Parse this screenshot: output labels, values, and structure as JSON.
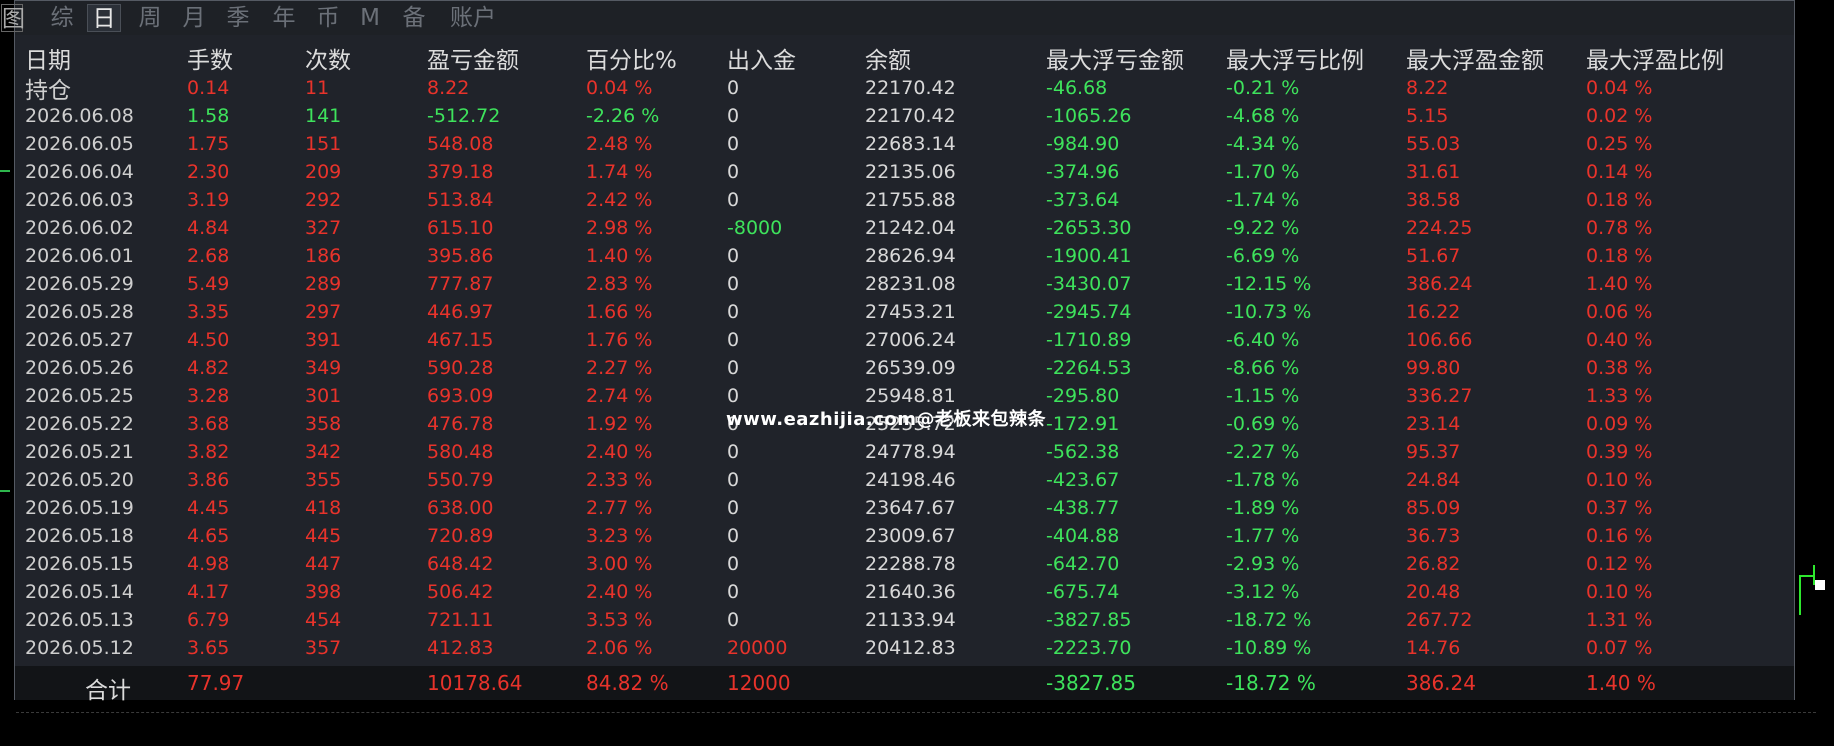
{
  "tabs": [
    "图",
    "综",
    "日",
    "周",
    "月",
    "季",
    "年",
    "币",
    "M",
    "备",
    "账户"
  ],
  "active_tab": "日",
  "columns": [
    "日期",
    "手数",
    "次数",
    "盈亏金额",
    "百分比%",
    "出入金",
    "余额",
    "最大浮亏金额",
    "最大浮亏比例",
    "最大浮盈金额",
    "最大浮盈比例"
  ],
  "colors": {
    "profit": "#e8332b",
    "loss": "#3ee35c",
    "neutral": "#d8d8d8",
    "panel": "#20232a"
  },
  "rows": [
    {
      "date": "持仓",
      "lots": "0.14",
      "count": "11",
      "pnl": "8.22",
      "pct": "0.04 %",
      "flow": "0",
      "balance": "22170.42",
      "maxloss": "-46.68",
      "maxloss_pct": "-0.21 %",
      "maxprofit": "8.22",
      "maxprofit_pct": "0.04 %",
      "tone": "red"
    },
    {
      "date": "2026.06.08",
      "lots": "1.58",
      "count": "141",
      "pnl": "-512.72",
      "pct": "-2.26 %",
      "flow": "0",
      "balance": "22170.42",
      "maxloss": "-1065.26",
      "maxloss_pct": "-4.68 %",
      "maxprofit": "5.15",
      "maxprofit_pct": "0.02 %",
      "tone": "green"
    },
    {
      "date": "2026.06.05",
      "lots": "1.75",
      "count": "151",
      "pnl": "548.08",
      "pct": "2.48 %",
      "flow": "0",
      "balance": "22683.14",
      "maxloss": "-984.90",
      "maxloss_pct": "-4.34 %",
      "maxprofit": "55.03",
      "maxprofit_pct": "0.25 %",
      "tone": "red"
    },
    {
      "date": "2026.06.04",
      "lots": "2.30",
      "count": "209",
      "pnl": "379.18",
      "pct": "1.74 %",
      "flow": "0",
      "balance": "22135.06",
      "maxloss": "-374.96",
      "maxloss_pct": "-1.70 %",
      "maxprofit": "31.61",
      "maxprofit_pct": "0.14 %",
      "tone": "red"
    },
    {
      "date": "2026.06.03",
      "lots": "3.19",
      "count": "292",
      "pnl": "513.84",
      "pct": "2.42 %",
      "flow": "0",
      "balance": "21755.88",
      "maxloss": "-373.64",
      "maxloss_pct": "-1.74 %",
      "maxprofit": "38.58",
      "maxprofit_pct": "0.18 %",
      "tone": "red"
    },
    {
      "date": "2026.06.02",
      "lots": "4.84",
      "count": "327",
      "pnl": "615.10",
      "pct": "2.98 %",
      "flow": "-8000",
      "balance": "21242.04",
      "maxloss": "-2653.30",
      "maxloss_pct": "-9.22 %",
      "maxprofit": "224.25",
      "maxprofit_pct": "0.78 %",
      "tone": "red",
      "flow_tone": "green"
    },
    {
      "date": "2026.06.01",
      "lots": "2.68",
      "count": "186",
      "pnl": "395.86",
      "pct": "1.40 %",
      "flow": "0",
      "balance": "28626.94",
      "maxloss": "-1900.41",
      "maxloss_pct": "-6.69 %",
      "maxprofit": "51.67",
      "maxprofit_pct": "0.18 %",
      "tone": "red"
    },
    {
      "date": "2026.05.29",
      "lots": "5.49",
      "count": "289",
      "pnl": "777.87",
      "pct": "2.83 %",
      "flow": "0",
      "balance": "28231.08",
      "maxloss": "-3430.07",
      "maxloss_pct": "-12.15 %",
      "maxprofit": "386.24",
      "maxprofit_pct": "1.40 %",
      "tone": "red"
    },
    {
      "date": "2026.05.28",
      "lots": "3.35",
      "count": "297",
      "pnl": "446.97",
      "pct": "1.66 %",
      "flow": "0",
      "balance": "27453.21",
      "maxloss": "-2945.74",
      "maxloss_pct": "-10.73 %",
      "maxprofit": "16.22",
      "maxprofit_pct": "0.06 %",
      "tone": "red"
    },
    {
      "date": "2026.05.27",
      "lots": "4.50",
      "count": "391",
      "pnl": "467.15",
      "pct": "1.76 %",
      "flow": "0",
      "balance": "27006.24",
      "maxloss": "-1710.89",
      "maxloss_pct": "-6.40 %",
      "maxprofit": "106.66",
      "maxprofit_pct": "0.40 %",
      "tone": "red"
    },
    {
      "date": "2026.05.26",
      "lots": "4.82",
      "count": "349",
      "pnl": "590.28",
      "pct": "2.27 %",
      "flow": "0",
      "balance": "26539.09",
      "maxloss": "-2264.53",
      "maxloss_pct": "-8.66 %",
      "maxprofit": "99.80",
      "maxprofit_pct": "0.38 %",
      "tone": "red"
    },
    {
      "date": "2026.05.25",
      "lots": "3.28",
      "count": "301",
      "pnl": "693.09",
      "pct": "2.74 %",
      "flow": "0",
      "balance": "25948.81",
      "maxloss": "-295.80",
      "maxloss_pct": "-1.15 %",
      "maxprofit": "336.27",
      "maxprofit_pct": "1.33 %",
      "tone": "red"
    },
    {
      "date": "2026.05.22",
      "lots": "3.68",
      "count": "358",
      "pnl": "476.78",
      "pct": "1.92 %",
      "flow": "0",
      "balance": "25255.72",
      "maxloss": "-172.91",
      "maxloss_pct": "-0.69 %",
      "maxprofit": "23.14",
      "maxprofit_pct": "0.09 %",
      "tone": "red"
    },
    {
      "date": "2026.05.21",
      "lots": "3.82",
      "count": "342",
      "pnl": "580.48",
      "pct": "2.40 %",
      "flow": "0",
      "balance": "24778.94",
      "maxloss": "-562.38",
      "maxloss_pct": "-2.27 %",
      "maxprofit": "95.37",
      "maxprofit_pct": "0.39 %",
      "tone": "red"
    },
    {
      "date": "2026.05.20",
      "lots": "3.86",
      "count": "355",
      "pnl": "550.79",
      "pct": "2.33 %",
      "flow": "0",
      "balance": "24198.46",
      "maxloss": "-423.67",
      "maxloss_pct": "-1.78 %",
      "maxprofit": "24.84",
      "maxprofit_pct": "0.10 %",
      "tone": "red"
    },
    {
      "date": "2026.05.19",
      "lots": "4.45",
      "count": "418",
      "pnl": "638.00",
      "pct": "2.77 %",
      "flow": "0",
      "balance": "23647.67",
      "maxloss": "-438.77",
      "maxloss_pct": "-1.89 %",
      "maxprofit": "85.09",
      "maxprofit_pct": "0.37 %",
      "tone": "red"
    },
    {
      "date": "2026.05.18",
      "lots": "4.65",
      "count": "445",
      "pnl": "720.89",
      "pct": "3.23 %",
      "flow": "0",
      "balance": "23009.67",
      "maxloss": "-404.88",
      "maxloss_pct": "-1.77 %",
      "maxprofit": "36.73",
      "maxprofit_pct": "0.16 %",
      "tone": "red"
    },
    {
      "date": "2026.05.15",
      "lots": "4.98",
      "count": "447",
      "pnl": "648.42",
      "pct": "3.00 %",
      "flow": "0",
      "balance": "22288.78",
      "maxloss": "-642.70",
      "maxloss_pct": "-2.93 %",
      "maxprofit": "26.82",
      "maxprofit_pct": "0.12 %",
      "tone": "red"
    },
    {
      "date": "2026.05.14",
      "lots": "4.17",
      "count": "398",
      "pnl": "506.42",
      "pct": "2.40 %",
      "flow": "0",
      "balance": "21640.36",
      "maxloss": "-675.74",
      "maxloss_pct": "-3.12 %",
      "maxprofit": "20.48",
      "maxprofit_pct": "0.10 %",
      "tone": "red"
    },
    {
      "date": "2026.05.13",
      "lots": "6.79",
      "count": "454",
      "pnl": "721.11",
      "pct": "3.53 %",
      "flow": "0",
      "balance": "21133.94",
      "maxloss": "-3827.85",
      "maxloss_pct": "-18.72 %",
      "maxprofit": "267.72",
      "maxprofit_pct": "1.31 %",
      "tone": "red"
    },
    {
      "date": "2026.05.12",
      "lots": "3.65",
      "count": "357",
      "pnl": "412.83",
      "pct": "2.06 %",
      "flow": "20000",
      "balance": "20412.83",
      "maxloss": "-2223.70",
      "maxloss_pct": "-10.89 %",
      "maxprofit": "14.76",
      "maxprofit_pct": "0.07 %",
      "tone": "red",
      "flow_tone": "red"
    }
  ],
  "total": {
    "label": "合计",
    "lots": "77.97",
    "pnl": "10178.64",
    "pct": "84.82 %",
    "flow": "12000",
    "maxloss": "-3827.85",
    "maxloss_pct": "-18.72 %",
    "maxprofit": "386.24",
    "maxprofit_pct": "1.40 %"
  },
  "watermark": "www.eazhijia.com@老板来包辣条"
}
